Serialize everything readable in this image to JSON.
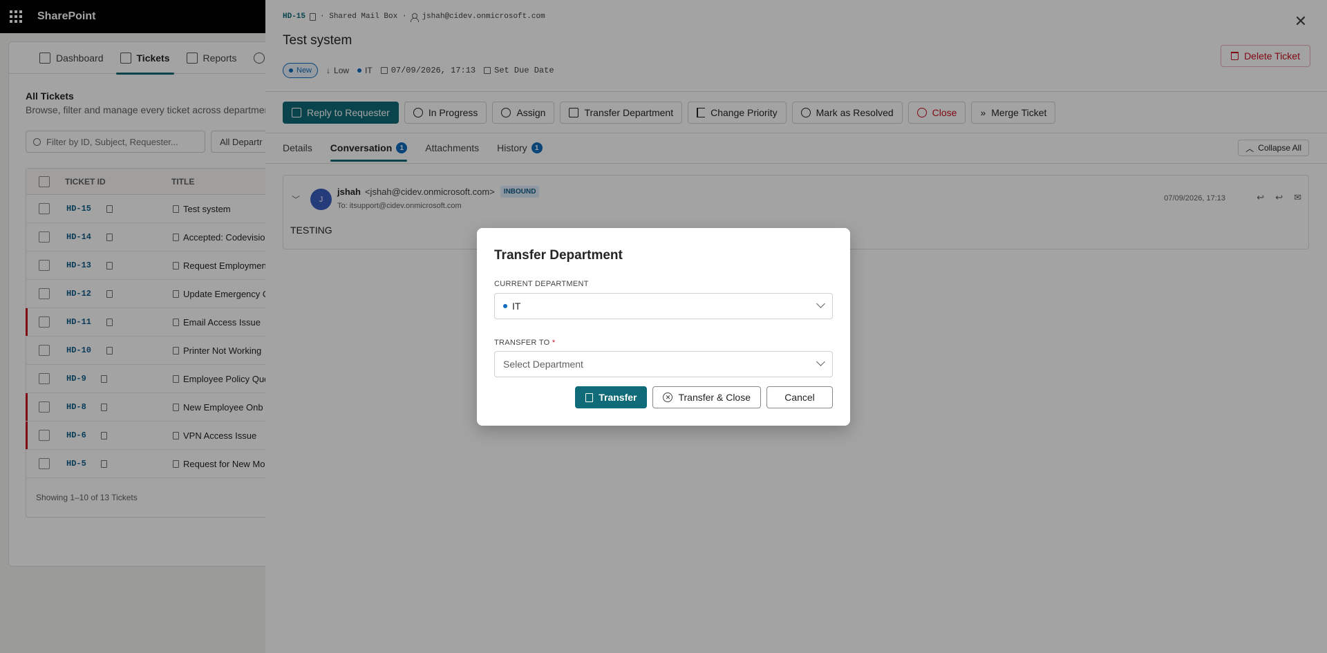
{
  "app": {
    "title": "SharePoint"
  },
  "nav": {
    "tabs": [
      "Dashboard",
      "Tickets",
      "Reports"
    ]
  },
  "list": {
    "title": "All Tickets",
    "subtitle": "Browse, filter and manage every ticket across departmen",
    "filter_placeholder": "Filter by ID, Subject, Requester...",
    "dept_filter": "All Departr",
    "col_id": "TICKET ID",
    "col_title": "TITLE",
    "rows": [
      {
        "id": "HD-15",
        "title": "Test system"
      },
      {
        "id": "HD-14",
        "title": "Accepted: Codevisio"
      },
      {
        "id": "HD-13",
        "title": "Request Employmen"
      },
      {
        "id": "HD-12",
        "title": "Update Emergency C"
      },
      {
        "id": "HD-11",
        "title": "Email Access Issue"
      },
      {
        "id": "HD-10",
        "title": "Printer Not Working"
      },
      {
        "id": "HD-9",
        "title": "Employee Policy Que"
      },
      {
        "id": "HD-8",
        "title": "New Employee Onb"
      },
      {
        "id": "HD-6",
        "title": "VPN Access Issue"
      },
      {
        "id": "HD-5",
        "title": "Request for New Mo"
      }
    ],
    "footer": "Showing 1–10 of 13 Tickets"
  },
  "ticket": {
    "id": "HD-15",
    "source": "· Shared Mail Box ·",
    "requester": "jshah@cidev.onmicrosoft.com",
    "title": "Test system",
    "status": "New",
    "priority": "Low",
    "department": "IT",
    "created": "07/09/2026, 17:13",
    "due_label": "Set Due Date",
    "delete_label": "Delete Ticket"
  },
  "actions": {
    "reply": "Reply to Requester",
    "in_progress": "In Progress",
    "assign": "Assign",
    "transfer": "Transfer Department",
    "priority": "Change Priority",
    "resolve": "Mark as Resolved",
    "close": "Close",
    "merge": "Merge Ticket"
  },
  "tabs": {
    "details": "Details",
    "conversation": "Conversation",
    "conversation_count": "1",
    "attachments": "Attachments",
    "history": "History",
    "history_count": "1",
    "collapse": "Collapse All"
  },
  "message": {
    "avatar": "J",
    "name": "jshah",
    "email": "<jshah@cidev.onmicrosoft.com>",
    "direction": "INBOUND",
    "to": "To: itsupport@cidev.onmicrosoft.com",
    "time": "07/09/2026, 17:13",
    "body": "TESTING"
  },
  "modal": {
    "title": "Transfer Department",
    "current_label": "CURRENT DEPARTMENT",
    "current_value": "IT",
    "transfer_label": "TRANSFER TO",
    "required_mark": "*",
    "transfer_placeholder": "Select Department",
    "transfer_btn": "Transfer",
    "transfer_close_btn": "Transfer & Close",
    "cancel_btn": "Cancel"
  },
  "colors": {
    "accent": "#0f6b78",
    "link": "#0f6cbd",
    "danger": "#c50f1f"
  }
}
